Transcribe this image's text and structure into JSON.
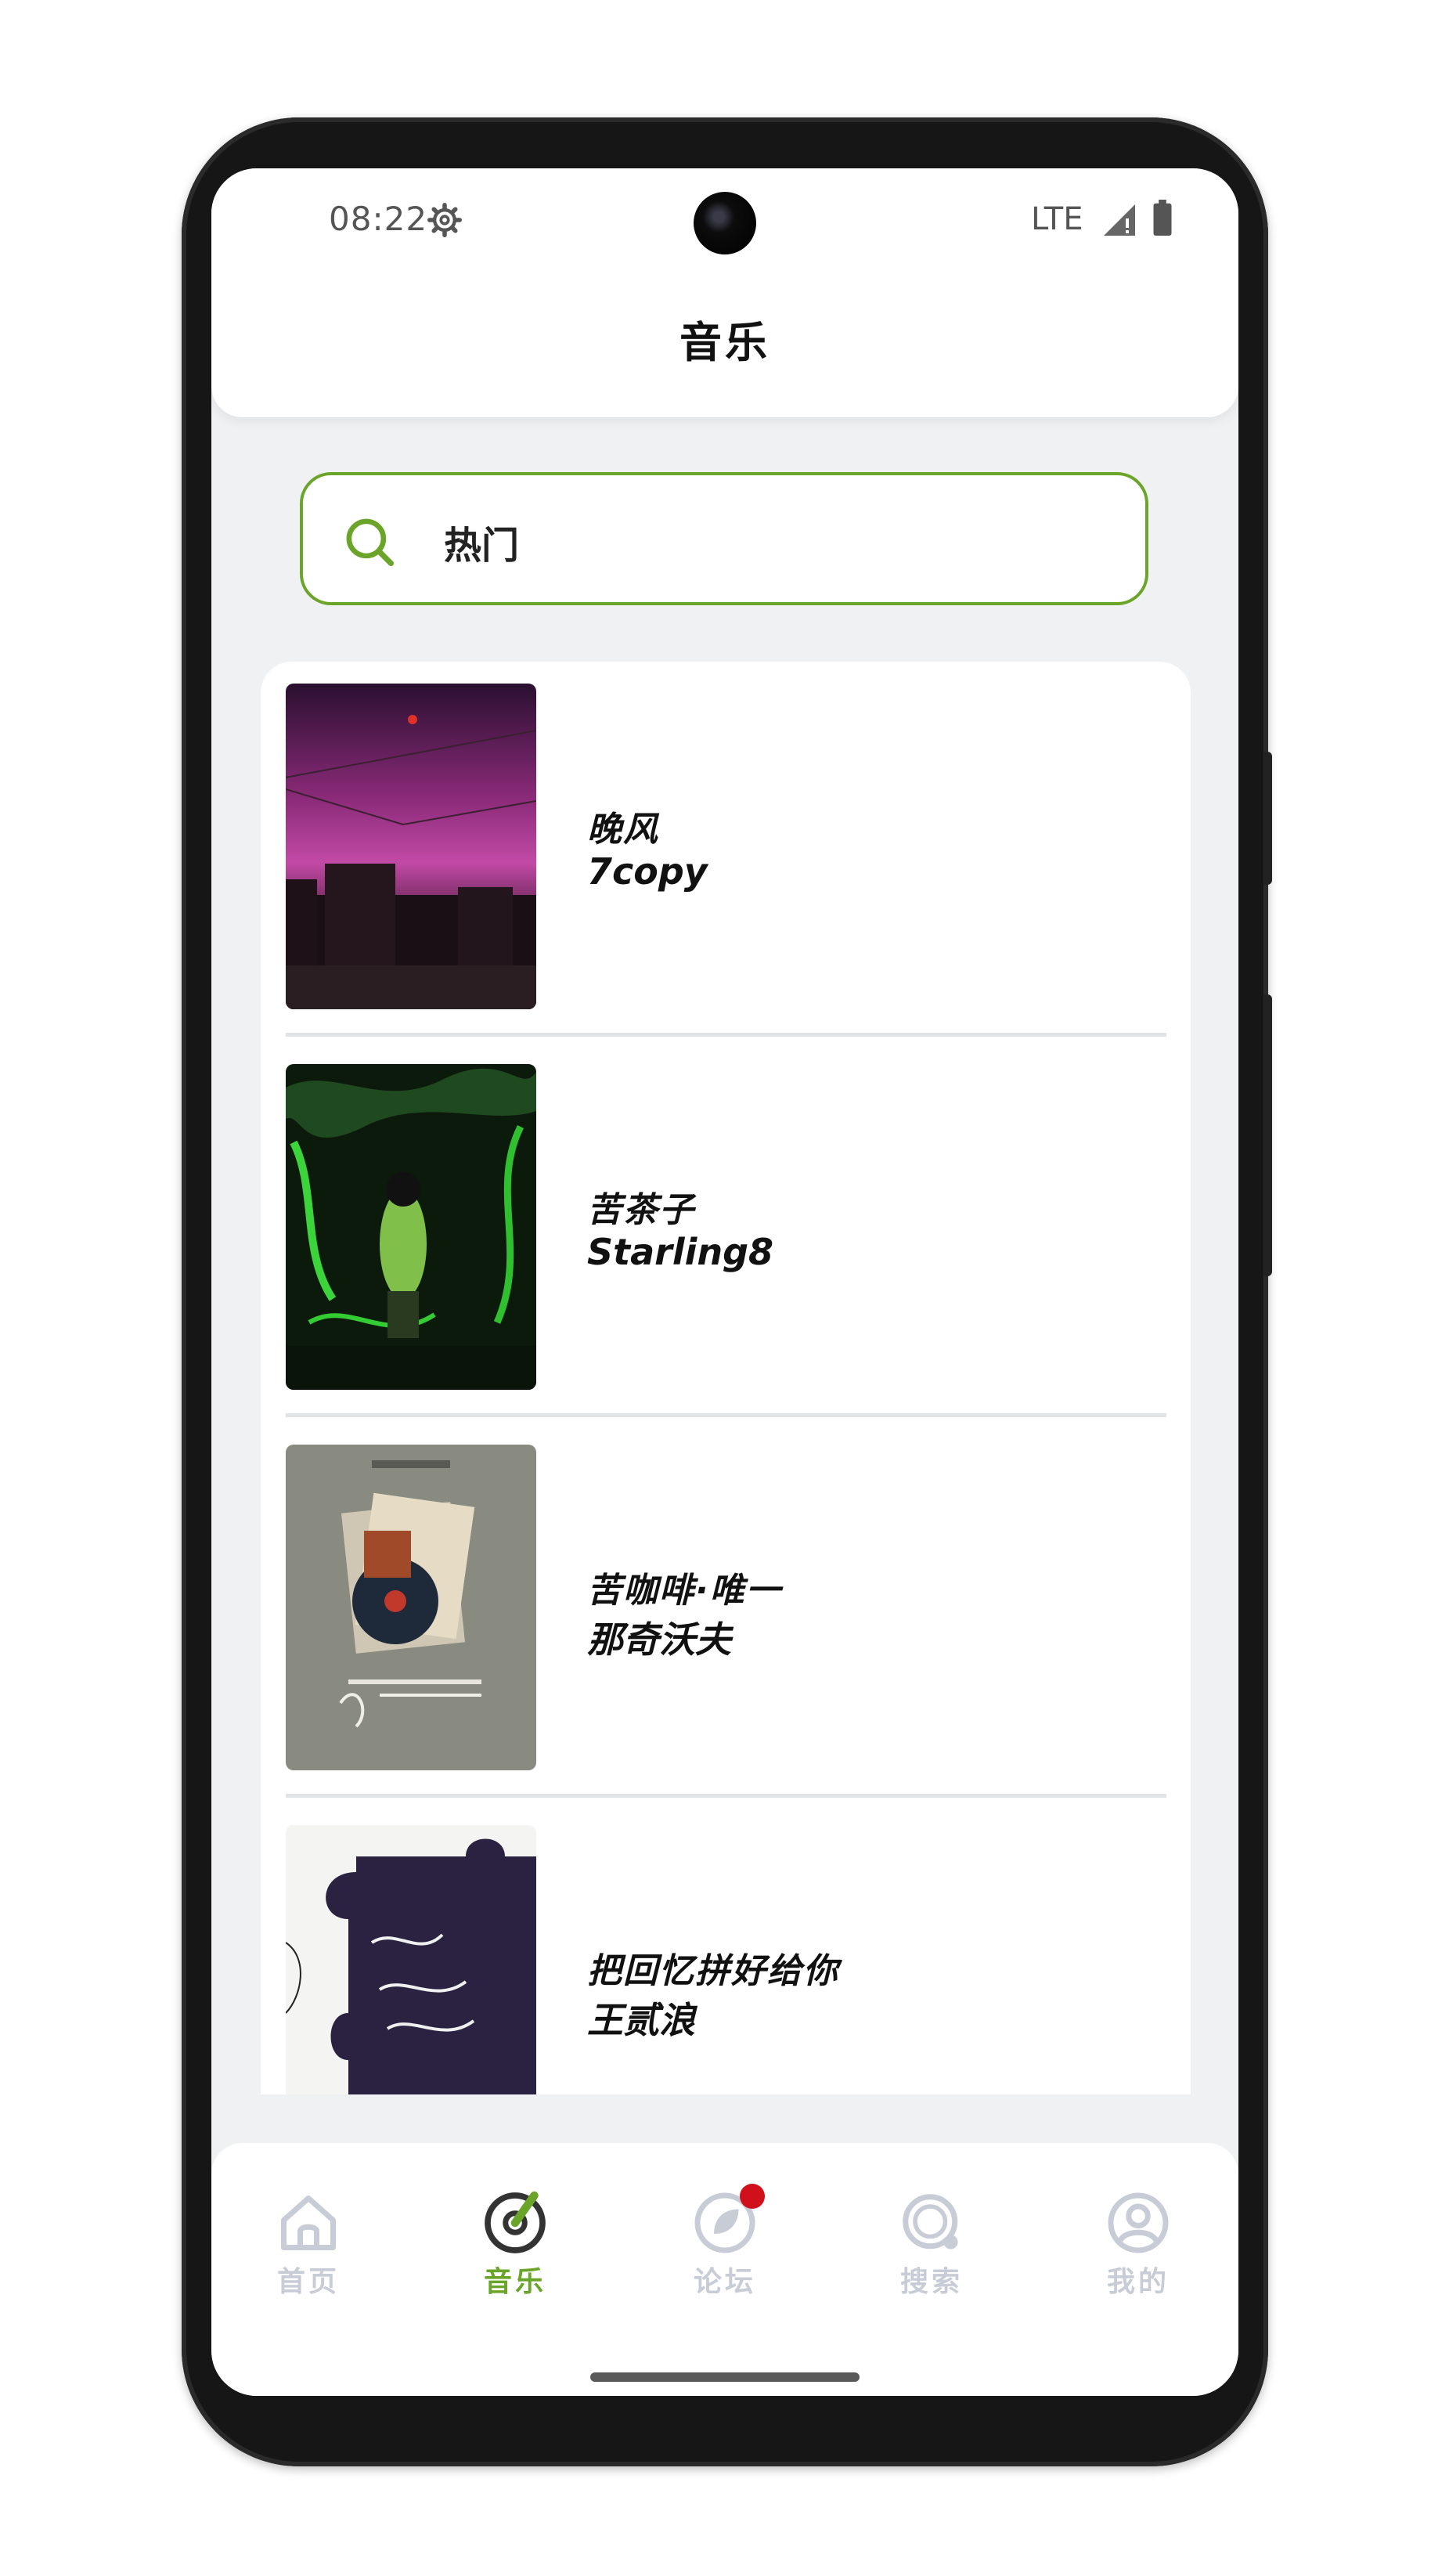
{
  "status_bar": {
    "time": "08:22",
    "network": "LTE",
    "icons": [
      "gear-icon",
      "signal-icon",
      "battery-icon"
    ]
  },
  "header": {
    "title": "音乐"
  },
  "search": {
    "value": "热门",
    "icon": "search-icon",
    "border_color": "#6aa52a"
  },
  "songs": [
    {
      "title": "晚风",
      "artist": "7copy",
      "cover": "dusk-city-cover"
    },
    {
      "title": "苦茶子",
      "artist": "Starling8",
      "cover": "green-jungle-cover"
    },
    {
      "title": "苦咖啡·唯一",
      "artist": "那奇沃夫",
      "cover": "miss-you-records-cover"
    },
    {
      "title": "把回忆拼好给你",
      "artist": "王贰浪",
      "cover": "puzzle-cover"
    }
  ],
  "bottom_nav": {
    "items": [
      {
        "label": "首页",
        "icon": "home-icon",
        "active": false
      },
      {
        "label": "音乐",
        "icon": "music-disc-icon",
        "active": true
      },
      {
        "label": "论坛",
        "icon": "forum-leaf-icon",
        "active": false,
        "badge": true
      },
      {
        "label": "搜索",
        "icon": "search-icon",
        "active": false
      },
      {
        "label": "我的",
        "icon": "profile-icon",
        "active": false
      }
    ]
  },
  "colors": {
    "accent": "#6aa52a",
    "inactive": "#c7ccd6",
    "badge": "#d0101a",
    "background": "#eff1f3"
  }
}
